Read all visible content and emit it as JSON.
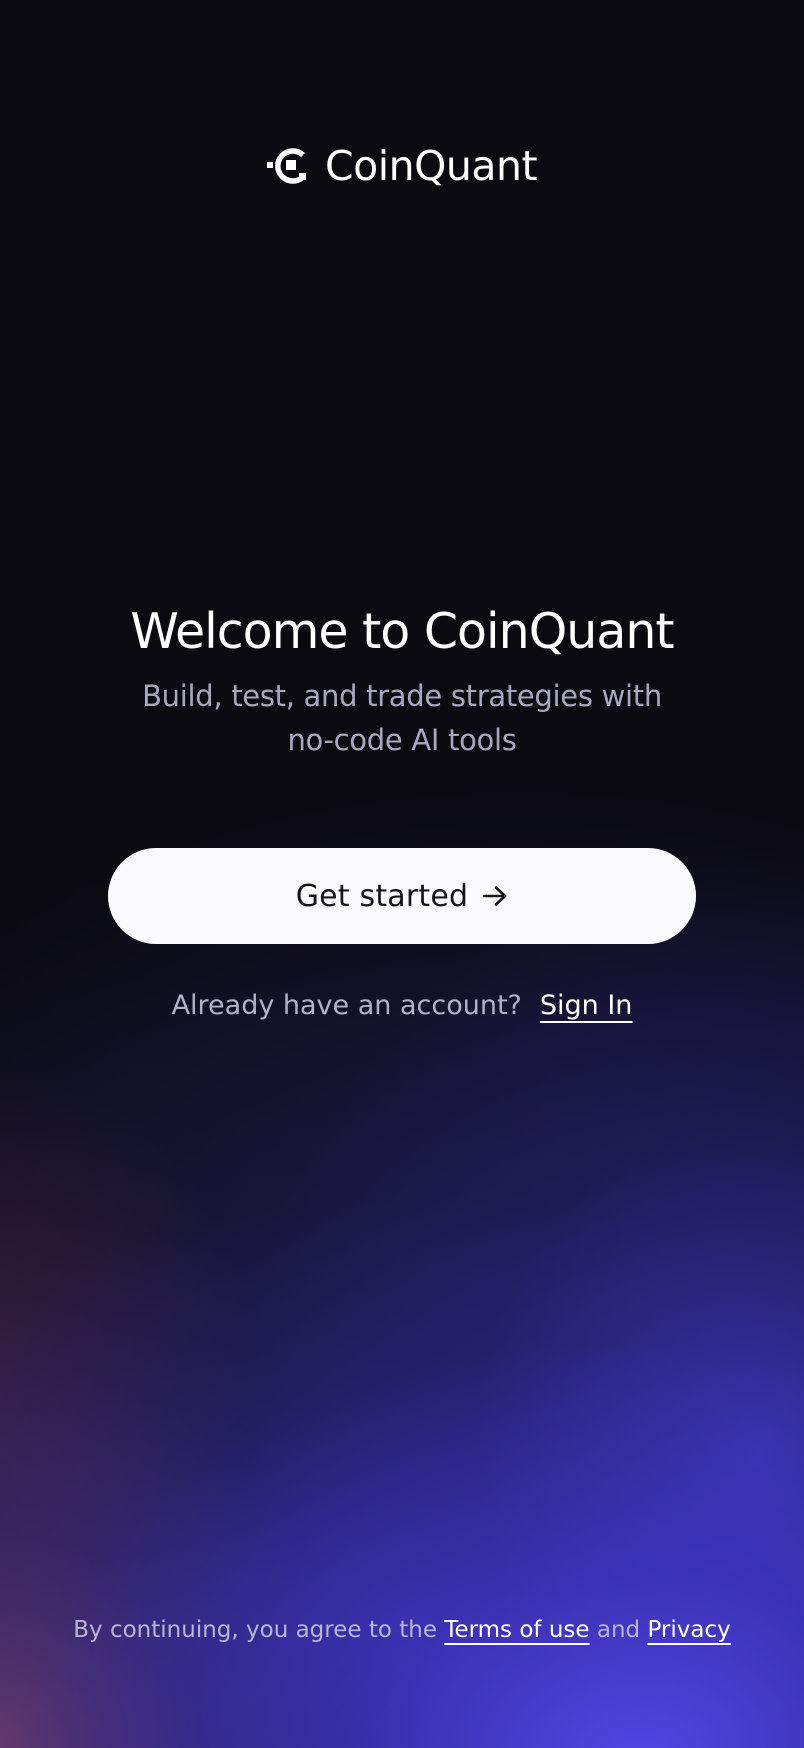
{
  "brand": {
    "name": "CoinQuant",
    "logo_icon": "coinquant-logo-icon"
  },
  "hero": {
    "title": "Welcome to CoinQuant",
    "subtitle": "Build, test, and trade strategies with no-code AI tools"
  },
  "cta": {
    "label": "Get started",
    "icon": "arrow-right-icon"
  },
  "signin": {
    "prompt": "Already have an account?",
    "link_label": "Sign In"
  },
  "legal": {
    "prefix": "By continuing, you agree to the",
    "terms_label": "Terms of use",
    "conjunction": "and",
    "privacy_label": "Privacy"
  },
  "colors": {
    "background": "#0b0a10",
    "button_bg": "#fbfbfd",
    "button_text": "#15141c",
    "muted_text": "#a9a6c0",
    "gradient_accent": "#5448ec"
  }
}
